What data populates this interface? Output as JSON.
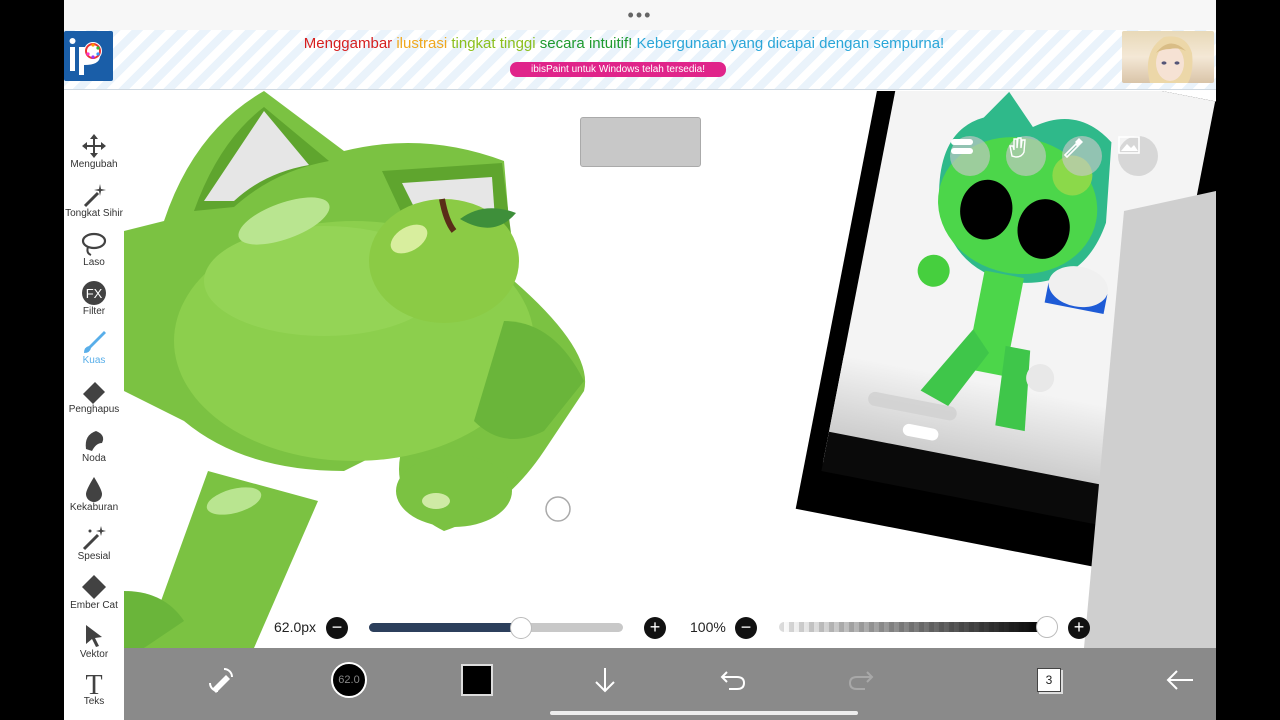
{
  "top_handle": "•••",
  "ad": {
    "headline_parts": [
      {
        "text": "Menggambar ",
        "color": "#d61f1f"
      },
      {
        "text": "ilustrasi ",
        "color": "#f0a81e"
      },
      {
        "text": "tingkat tinggi ",
        "color": "#8bbf1e"
      },
      {
        "text": "secara intuitif! ",
        "color": "#1e9a2e"
      },
      {
        "text": "Kebergunaan yang dicapai dengan sempurna!",
        "color": "#2aa6d8"
      }
    ],
    "cta": "ibisPaint untuk Windows telah tersedia!"
  },
  "tools": [
    {
      "label": "Mengubah",
      "icon": "move-icon"
    },
    {
      "label": "Tongkat Sihir",
      "icon": "magic-wand-icon"
    },
    {
      "label": "Laso",
      "icon": "lasso-icon"
    },
    {
      "label": "Filter",
      "icon": "fx-icon"
    },
    {
      "label": "Kuas",
      "icon": "brush-icon"
    },
    {
      "label": "Penghapus",
      "icon": "eraser-icon"
    },
    {
      "label": "Noda",
      "icon": "smudge-icon"
    },
    {
      "label": "Kekaburan",
      "icon": "blur-icon"
    },
    {
      "label": "Spesial",
      "icon": "special-icon"
    },
    {
      "label": "Ember Cat",
      "icon": "paint-bucket-icon"
    },
    {
      "label": "Vektor",
      "icon": "vector-icon"
    },
    {
      "label": "Teks",
      "icon": "text-icon"
    }
  ],
  "active_tool": "Kuas",
  "brush": {
    "size_label": "62.0px",
    "size_fraction": 0.6,
    "circle_label": "62.0"
  },
  "opacity": {
    "label": "100%",
    "fraction": 1.0
  },
  "layer_count": "3",
  "colors": {
    "accent": "#4aa8e8",
    "primary_color": "#000000",
    "bottom_bar": "#8a8a8a"
  }
}
